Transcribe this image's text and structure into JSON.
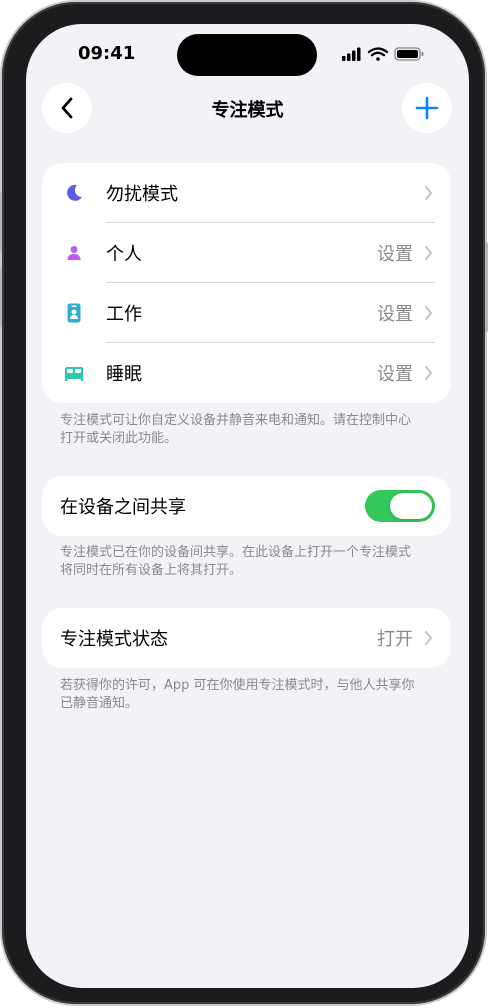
{
  "status_bar": {
    "time": "09:41"
  },
  "nav": {
    "title": "专注模式"
  },
  "focus_modes": [
    {
      "label": "勿扰模式",
      "value": "",
      "icon": "moon-icon",
      "color": "#5e5ce6"
    },
    {
      "label": "个人",
      "value": "设置",
      "icon": "person-icon",
      "color": "#bf5af2"
    },
    {
      "label": "工作",
      "value": "设置",
      "icon": "badge-icon",
      "color": "#30b0c7"
    },
    {
      "label": "睡眠",
      "value": "设置",
      "icon": "bed-icon",
      "color": "#30c7b0"
    }
  ],
  "focus_footnote": "专注模式可让你自定义设备并静音来电和通知。请在控制中心打开或关闭此功能。",
  "share": {
    "label": "在设备之间共享",
    "enabled": true
  },
  "share_footnote": "专注模式已在你的设备间共享。在此设备上打开一个专注模式将同时在所有设备上将其打开。",
  "status": {
    "label": "专注模式状态",
    "value": "打开"
  },
  "status_footnote": "若获得你的许可，App 可在你使用专注模式时，与他人共享你已静音通知。",
  "colors": {
    "accent": "#34c759",
    "link": "#0a84ff"
  }
}
